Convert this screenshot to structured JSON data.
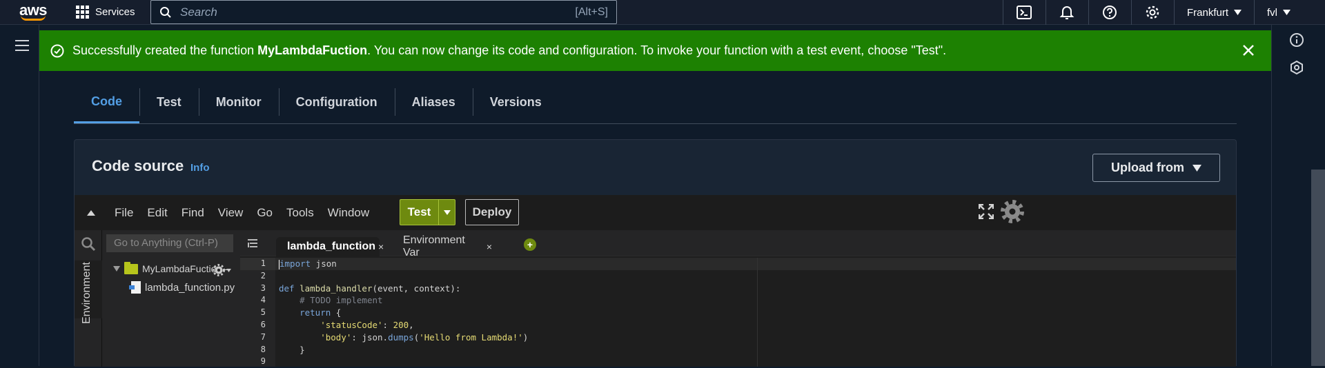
{
  "topnav": {
    "logo_text": "aws",
    "services_label": "Services",
    "search_placeholder": "Search",
    "search_shortcut": "[Alt+S]",
    "icons": [
      "cloudshell-icon",
      "bell-icon",
      "help-icon",
      "settings-icon"
    ],
    "region_label": "Frankfurt",
    "user_label": "fvl"
  },
  "flash": {
    "prefix": "Successfully created the function ",
    "function_name": "MyLambdaFuction",
    "suffix": ". You can now change its code and configuration. To invoke your function with a test event, choose \"Test\".",
    "color": "#1d8102"
  },
  "tabs": [
    {
      "label": "Code",
      "active": true
    },
    {
      "label": "Test"
    },
    {
      "label": "Monitor"
    },
    {
      "label": "Configuration"
    },
    {
      "label": "Aliases"
    },
    {
      "label": "Versions"
    }
  ],
  "code_source": {
    "title": "Code source",
    "info_label": "Info",
    "upload_label": "Upload from"
  },
  "ide": {
    "menu": [
      "File",
      "Edit",
      "Find",
      "View",
      "Go",
      "Tools",
      "Window"
    ],
    "test_label": "Test",
    "deploy_label": "Deploy",
    "goto_placeholder": "Go to Anything (Ctrl-P)",
    "environment_label": "Environment",
    "folder_name": "MyLambdaFuction -",
    "file_name": "lambda_function.py",
    "editor_tabs": [
      {
        "label": "lambda_function",
        "close": "×",
        "active": true
      },
      {
        "label": "Environment Var",
        "close": "×"
      }
    ],
    "add_tab": "+",
    "line_numbers": [
      "1",
      "2",
      "3",
      "4",
      "5",
      "6",
      "7",
      "8",
      "9"
    ],
    "accent_green": "#6e8a0f"
  }
}
